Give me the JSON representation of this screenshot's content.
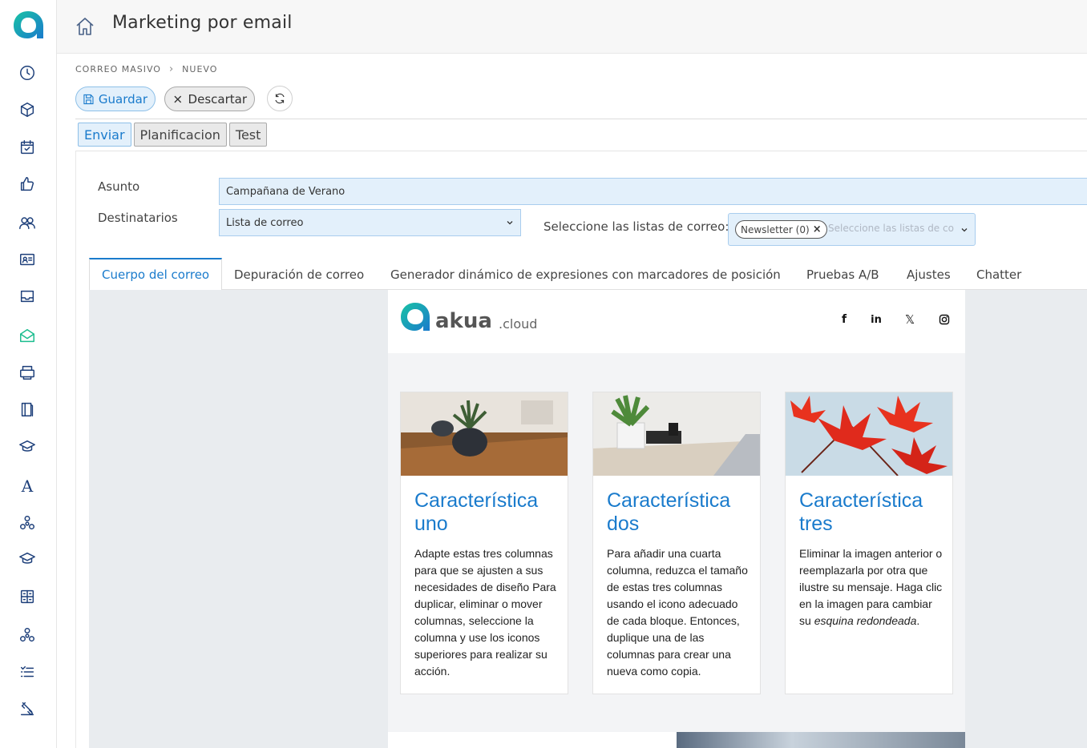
{
  "header": {
    "title": "Marketing por email"
  },
  "breadcrumb": {
    "items": [
      "CORREO MASIVO",
      "NUEVO"
    ]
  },
  "toolbar": {
    "save_label": "Guardar",
    "discard_label": "Descartar"
  },
  "subtabs": [
    "Enviar",
    "Planificacion",
    "Test"
  ],
  "form": {
    "subject_label": "Asunto",
    "subject_value": "Campañana de Verano",
    "recipients_label": "Destinatarios",
    "recipients_value": "Lista de correo",
    "lists_label": "Seleccione las listas de correo:",
    "lists_chip": "Newsletter (0)",
    "lists_placeholder": "Seleccione las listas de correo"
  },
  "tabs": [
    "Cuerpo del correo",
    "Depuración de correo",
    "Generador dinámico de expresiones con marcadores de posición",
    "Pruebas A/B",
    "Ajustes",
    "Chatter"
  ],
  "email": {
    "logo_main": "akua",
    "logo_suffix": ".cloud",
    "social": [
      "facebook-icon",
      "linkedin-icon",
      "x-icon",
      "instagram-icon"
    ],
    "cards": [
      {
        "title": "Característica uno",
        "text": "Adapte estas tres columnas para que se ajusten a sus necesidades de diseño Para duplicar, eliminar o mover columnas, seleccione la columna y use los iconos superiores para realizar su acción."
      },
      {
        "title": "Característica dos",
        "text": "Para añadir una cuarta columna, reduzca el tamaño de estas tres columnas usando el icono adecuado de cada bloque. Entonces, duplique una de las columnas para crear una nueva como copia."
      },
      {
        "title": "Característica tres",
        "text_plain": "Eliminar la imagen anterior o reemplazarla por otra que ilustre su mensaje. Haga clic en la imagen para cambiar su",
        "text_italic": "esquina redondeada",
        "text_end": "."
      }
    ]
  },
  "colors": {
    "accent": "#1a7bcc",
    "active_nav": "#1bbd8f",
    "field_bg": "#e3f0fb"
  }
}
